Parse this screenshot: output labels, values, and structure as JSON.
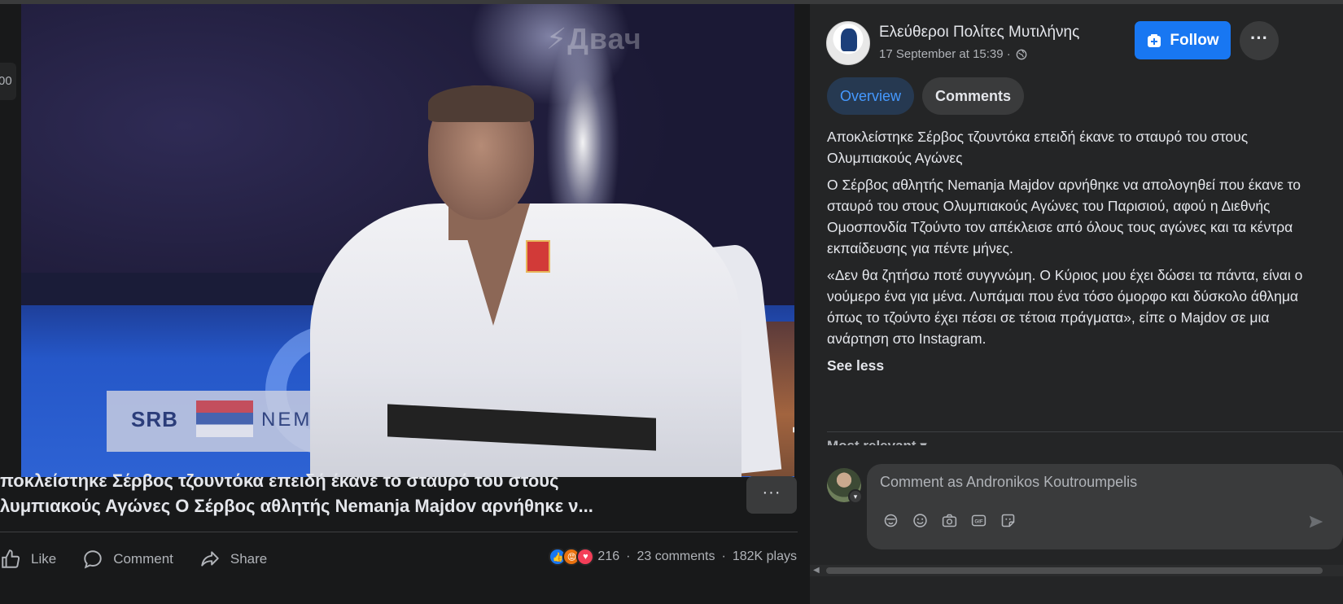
{
  "video": {
    "watermark": "⚡Двач",
    "banner_country": "SRB",
    "banner_name": "NEMANJA MAJDOV",
    "side_chip_text": "00"
  },
  "post_title": {
    "line1": "ποκλείστηκε Σέρβος τζουντόκα επειδή έκανε το σταυρό του στους",
    "line2": "λυμπιακούς Αγώνες Ο Σέρβος αθλητής Nemanja Majdov αρνήθηκε ν..."
  },
  "more_button_label": "···",
  "actions": {
    "like": "Like",
    "comment": "Comment",
    "share": "Share"
  },
  "stats": {
    "reaction_count": "216",
    "comments": "23 comments",
    "plays": "182K plays",
    "separator": "·"
  },
  "page": {
    "name": "Ελεύθεροι Πολίτες Μυτιλήνης",
    "time": "17 September at 15:39 ·",
    "follow_label": "Follow",
    "more_label": "···"
  },
  "tabs": [
    {
      "label": "Overview"
    },
    {
      "label": "Comments"
    }
  ],
  "post": {
    "p1": "Αποκλείστηκε Σέρβος τζουντόκα επειδή έκανε το σταυρό του στους Ολυμπιακούς Αγώνες",
    "p2": "Ο Σέρβος αθλητής Nemanja Majdov αρνήθηκε να απολογηθεί που έκανε το σταυρό του στους Ολυμπιακούς Αγώνες του Παρισιού, αφού η Διεθνής Ομοσπονδία Τζούντο τον απέκλεισε από όλους τους αγώνες και τα κέντρα εκπαίδευσης για πέντε μήνες.",
    "p3": "«Δεν θα ζητήσω ποτέ συγγνώμη. Ο Κύριος μου έχει δώσει τα πάντα, είναι ο νούμερο ένα για μένα. Λυπάμαι που ένα τόσο όμορφο και δύσκολο άθλημα όπως το τζούντο έχει πέσει σε τέτοια πράγματα», είπε ο Majdov σε μια ανάρτηση στο Instagram.",
    "see_less": "See less"
  },
  "sort_label": "Most relevant ▾",
  "comment_box": {
    "placeholder": "Comment as Andronikos Koutroumpelis",
    "user_badge": "▾"
  },
  "colors": {
    "accent": "#1877f2",
    "tab_active_bg": "#263951",
    "tab_active_text": "#4599ff"
  }
}
